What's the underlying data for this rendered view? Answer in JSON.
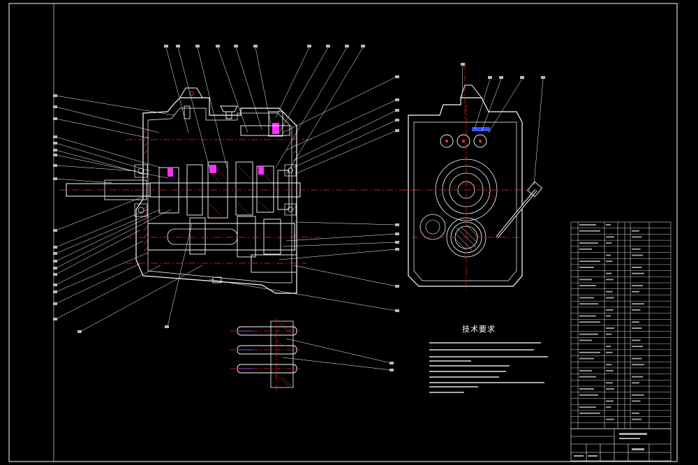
{
  "drawing": {
    "technical_requirements_title": "技术要求"
  },
  "colors": {
    "background": "#000000",
    "outline": "#ffffff",
    "centerline": "#ff2020",
    "hatch": "#ff3030",
    "gear": "#ff4040",
    "highlight": "#ff30ff",
    "blue_mark": "#3050ff",
    "leader": "#ffffff"
  }
}
